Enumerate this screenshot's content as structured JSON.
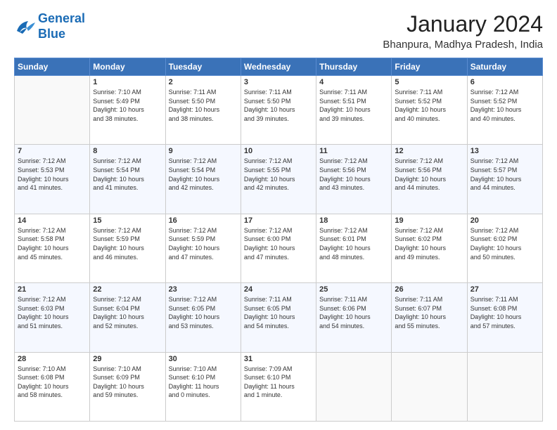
{
  "logo": {
    "line1": "General",
    "line2": "Blue"
  },
  "title": "January 2024",
  "location": "Bhanpura, Madhya Pradesh, India",
  "headers": [
    "Sunday",
    "Monday",
    "Tuesday",
    "Wednesday",
    "Thursday",
    "Friday",
    "Saturday"
  ],
  "weeks": [
    [
      {
        "day": "",
        "text": ""
      },
      {
        "day": "1",
        "text": "Sunrise: 7:10 AM\nSunset: 5:49 PM\nDaylight: 10 hours\nand 38 minutes."
      },
      {
        "day": "2",
        "text": "Sunrise: 7:11 AM\nSunset: 5:50 PM\nDaylight: 10 hours\nand 38 minutes."
      },
      {
        "day": "3",
        "text": "Sunrise: 7:11 AM\nSunset: 5:50 PM\nDaylight: 10 hours\nand 39 minutes."
      },
      {
        "day": "4",
        "text": "Sunrise: 7:11 AM\nSunset: 5:51 PM\nDaylight: 10 hours\nand 39 minutes."
      },
      {
        "day": "5",
        "text": "Sunrise: 7:11 AM\nSunset: 5:52 PM\nDaylight: 10 hours\nand 40 minutes."
      },
      {
        "day": "6",
        "text": "Sunrise: 7:12 AM\nSunset: 5:52 PM\nDaylight: 10 hours\nand 40 minutes."
      }
    ],
    [
      {
        "day": "7",
        "text": "Sunrise: 7:12 AM\nSunset: 5:53 PM\nDaylight: 10 hours\nand 41 minutes."
      },
      {
        "day": "8",
        "text": "Sunrise: 7:12 AM\nSunset: 5:54 PM\nDaylight: 10 hours\nand 41 minutes."
      },
      {
        "day": "9",
        "text": "Sunrise: 7:12 AM\nSunset: 5:54 PM\nDaylight: 10 hours\nand 42 minutes."
      },
      {
        "day": "10",
        "text": "Sunrise: 7:12 AM\nSunset: 5:55 PM\nDaylight: 10 hours\nand 42 minutes."
      },
      {
        "day": "11",
        "text": "Sunrise: 7:12 AM\nSunset: 5:56 PM\nDaylight: 10 hours\nand 43 minutes."
      },
      {
        "day": "12",
        "text": "Sunrise: 7:12 AM\nSunset: 5:56 PM\nDaylight: 10 hours\nand 44 minutes."
      },
      {
        "day": "13",
        "text": "Sunrise: 7:12 AM\nSunset: 5:57 PM\nDaylight: 10 hours\nand 44 minutes."
      }
    ],
    [
      {
        "day": "14",
        "text": "Sunrise: 7:12 AM\nSunset: 5:58 PM\nDaylight: 10 hours\nand 45 minutes."
      },
      {
        "day": "15",
        "text": "Sunrise: 7:12 AM\nSunset: 5:59 PM\nDaylight: 10 hours\nand 46 minutes."
      },
      {
        "day": "16",
        "text": "Sunrise: 7:12 AM\nSunset: 5:59 PM\nDaylight: 10 hours\nand 47 minutes."
      },
      {
        "day": "17",
        "text": "Sunrise: 7:12 AM\nSunset: 6:00 PM\nDaylight: 10 hours\nand 47 minutes."
      },
      {
        "day": "18",
        "text": "Sunrise: 7:12 AM\nSunset: 6:01 PM\nDaylight: 10 hours\nand 48 minutes."
      },
      {
        "day": "19",
        "text": "Sunrise: 7:12 AM\nSunset: 6:02 PM\nDaylight: 10 hours\nand 49 minutes."
      },
      {
        "day": "20",
        "text": "Sunrise: 7:12 AM\nSunset: 6:02 PM\nDaylight: 10 hours\nand 50 minutes."
      }
    ],
    [
      {
        "day": "21",
        "text": "Sunrise: 7:12 AM\nSunset: 6:03 PM\nDaylight: 10 hours\nand 51 minutes."
      },
      {
        "day": "22",
        "text": "Sunrise: 7:12 AM\nSunset: 6:04 PM\nDaylight: 10 hours\nand 52 minutes."
      },
      {
        "day": "23",
        "text": "Sunrise: 7:12 AM\nSunset: 6:05 PM\nDaylight: 10 hours\nand 53 minutes."
      },
      {
        "day": "24",
        "text": "Sunrise: 7:11 AM\nSunset: 6:05 PM\nDaylight: 10 hours\nand 54 minutes."
      },
      {
        "day": "25",
        "text": "Sunrise: 7:11 AM\nSunset: 6:06 PM\nDaylight: 10 hours\nand 54 minutes."
      },
      {
        "day": "26",
        "text": "Sunrise: 7:11 AM\nSunset: 6:07 PM\nDaylight: 10 hours\nand 55 minutes."
      },
      {
        "day": "27",
        "text": "Sunrise: 7:11 AM\nSunset: 6:08 PM\nDaylight: 10 hours\nand 57 minutes."
      }
    ],
    [
      {
        "day": "28",
        "text": "Sunrise: 7:10 AM\nSunset: 6:08 PM\nDaylight: 10 hours\nand 58 minutes."
      },
      {
        "day": "29",
        "text": "Sunrise: 7:10 AM\nSunset: 6:09 PM\nDaylight: 10 hours\nand 59 minutes."
      },
      {
        "day": "30",
        "text": "Sunrise: 7:10 AM\nSunset: 6:10 PM\nDaylight: 11 hours\nand 0 minutes."
      },
      {
        "day": "31",
        "text": "Sunrise: 7:09 AM\nSunset: 6:10 PM\nDaylight: 11 hours\nand 1 minute."
      },
      {
        "day": "",
        "text": ""
      },
      {
        "day": "",
        "text": ""
      },
      {
        "day": "",
        "text": ""
      }
    ]
  ]
}
